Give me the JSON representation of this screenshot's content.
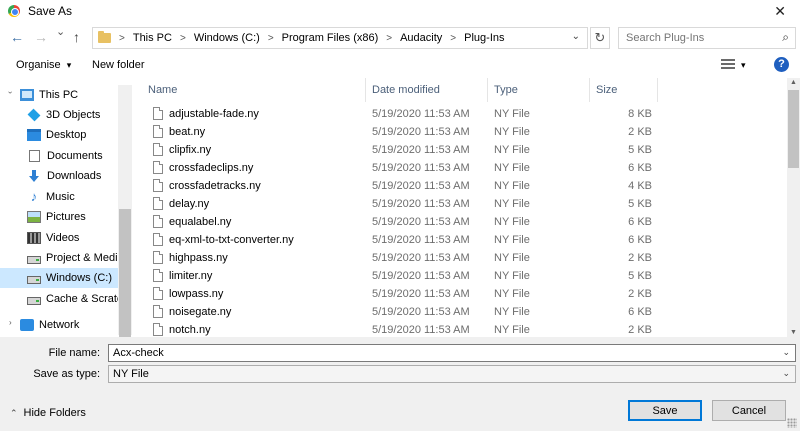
{
  "window": {
    "title": "Save As",
    "close_glyph": "✕"
  },
  "nav": {
    "back_glyph": "←",
    "forward_glyph": "→",
    "recent_glyph": "⌄",
    "up_glyph": "↑",
    "refresh_glyph": "↻",
    "addr_dropdown_glyph": "⌄"
  },
  "breadcrumb": [
    "This PC",
    "Windows (C:)",
    "Program Files (x86)",
    "Audacity",
    "Plug-Ins"
  ],
  "breadcrumb_sep": ">",
  "search": {
    "placeholder": "Search Plug-Ins",
    "glyph": "⌕"
  },
  "toolbar": {
    "organise": "Organise",
    "organise_chevron": "▾",
    "new_folder": "New folder",
    "view_chevron": "▾",
    "help": "?"
  },
  "sidebar": {
    "expand_chevron": "›",
    "items": [
      {
        "label": "This PC",
        "icon": "pc-icon",
        "selected": false
      },
      {
        "label": "3D Objects",
        "icon": "cube-icon",
        "selected": false
      },
      {
        "label": "Desktop",
        "icon": "desktop-icon",
        "selected": false
      },
      {
        "label": "Documents",
        "icon": "documents-icon",
        "selected": false
      },
      {
        "label": "Downloads",
        "icon": "downloads-icon",
        "selected": false
      },
      {
        "label": "Music",
        "icon": "music-icon",
        "selected": false
      },
      {
        "label": "Pictures",
        "icon": "pictures-icon",
        "selected": false
      },
      {
        "label": "Videos",
        "icon": "videos-icon",
        "selected": false
      },
      {
        "label": "Project & Media",
        "icon": "drive-icon",
        "selected": false
      },
      {
        "label": "Windows (C:)",
        "icon": "drive-icon",
        "selected": true
      },
      {
        "label": "Cache & Scratch",
        "icon": "drive-icon",
        "selected": false
      },
      {
        "label": "Network",
        "icon": "network-icon",
        "selected": false
      }
    ]
  },
  "columns": {
    "name": "Name",
    "date": "Date modified",
    "type": "Type",
    "size": "Size",
    "sort_indicator": "^"
  },
  "files": [
    {
      "name": "adjustable-fade.ny",
      "date": "5/19/2020 11:53 AM",
      "type": "NY File",
      "size": "8 KB"
    },
    {
      "name": "beat.ny",
      "date": "5/19/2020 11:53 AM",
      "type": "NY File",
      "size": "2 KB"
    },
    {
      "name": "clipfix.ny",
      "date": "5/19/2020 11:53 AM",
      "type": "NY File",
      "size": "5 KB"
    },
    {
      "name": "crossfadeclips.ny",
      "date": "5/19/2020 11:53 AM",
      "type": "NY File",
      "size": "6 KB"
    },
    {
      "name": "crossfadetracks.ny",
      "date": "5/19/2020 11:53 AM",
      "type": "NY File",
      "size": "4 KB"
    },
    {
      "name": "delay.ny",
      "date": "5/19/2020 11:53 AM",
      "type": "NY File",
      "size": "5 KB"
    },
    {
      "name": "equalabel.ny",
      "date": "5/19/2020 11:53 AM",
      "type": "NY File",
      "size": "6 KB"
    },
    {
      "name": "eq-xml-to-txt-converter.ny",
      "date": "5/19/2020 11:53 AM",
      "type": "NY File",
      "size": "6 KB"
    },
    {
      "name": "highpass.ny",
      "date": "5/19/2020 11:53 AM",
      "type": "NY File",
      "size": "2 KB"
    },
    {
      "name": "limiter.ny",
      "date": "5/19/2020 11:53 AM",
      "type": "NY File",
      "size": "5 KB"
    },
    {
      "name": "lowpass.ny",
      "date": "5/19/2020 11:53 AM",
      "type": "NY File",
      "size": "2 KB"
    },
    {
      "name": "noisegate.ny",
      "date": "5/19/2020 11:53 AM",
      "type": "NY File",
      "size": "6 KB"
    },
    {
      "name": "notch.ny",
      "date": "5/19/2020 11:53 AM",
      "type": "NY File",
      "size": "2 KB"
    }
  ],
  "form": {
    "filename_label": "File name:",
    "filename_value": "Acx-check",
    "savetype_label": "Save as type:",
    "savetype_value": "NY File",
    "dropdown_glyph": "⌄"
  },
  "footer": {
    "hide_folders": "Hide Folders",
    "hide_chevron": "⌃",
    "save": "Save",
    "cancel": "Cancel"
  },
  "scrollbar": {
    "up": "▲",
    "down": "▼"
  },
  "colors": {
    "selection": "#cce8ff",
    "accent": "#0078d7",
    "help": "#1f5fbf",
    "folder": "#e8c163"
  }
}
